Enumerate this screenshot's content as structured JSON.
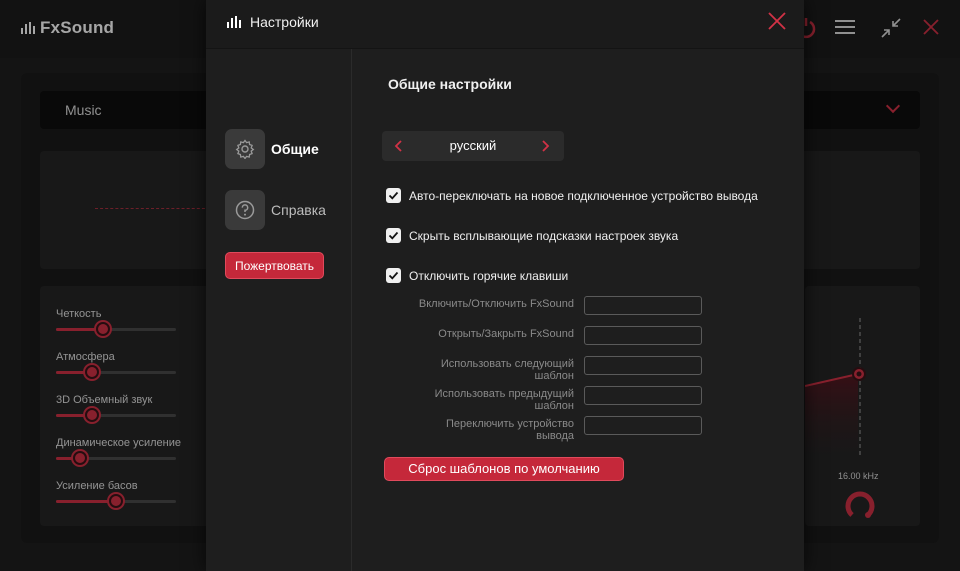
{
  "app": {
    "logo_text": "FxSound",
    "preset": "Music",
    "effects": [
      {
        "label": "Четкость",
        "level": 0.39
      },
      {
        "label": "Атмосфера",
        "level": 0.3
      },
      {
        "label": "3D Объемный звук",
        "level": 0.3
      },
      {
        "label": "Динамическое усиление",
        "level": 0.2
      },
      {
        "label": "Усиление басов",
        "level": 0.5
      }
    ],
    "eq_freq_label": "16.00 kHz"
  },
  "dialog": {
    "title": "Настройки",
    "nav": [
      {
        "label": "Общие",
        "icon": "gear-icon",
        "active": true
      },
      {
        "label": "Справка",
        "icon": "help-icon",
        "active": false
      }
    ],
    "donate_label": "Пожертвовать",
    "section_title": "Общие настройки",
    "language": "русский",
    "checkboxes": [
      {
        "label": "Авто-переключать на новое подключенное устройство вывода",
        "checked": true
      },
      {
        "label": "Скрыть всплывающие подсказки настроек звука",
        "checked": true
      },
      {
        "label": "Отключить горячие клавиши",
        "checked": true
      }
    ],
    "hotkeys": [
      {
        "label": "Включить/Отключить FxSound",
        "value": ""
      },
      {
        "label": "Открыть/Закрыть FxSound",
        "value": ""
      },
      {
        "label": "Использовать следующий шаблон",
        "value": ""
      },
      {
        "label": "Использовать предыдущий шаблон",
        "value": ""
      },
      {
        "label": "Переключить устройство вывода",
        "value": ""
      }
    ],
    "reset_label": "Сброс шаблонов по умолчанию"
  },
  "colors": {
    "accent": "#d23246",
    "background": "#202020",
    "dialog": "#1e1e1e"
  }
}
